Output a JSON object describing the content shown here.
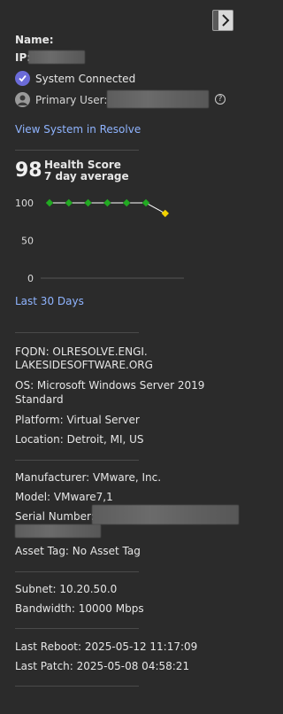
{
  "panel": {
    "collapse_icon": "chevron-right-icon"
  },
  "identity": {
    "name_label": "Name:",
    "ip_label": "IP:",
    "status_text": "System Connected",
    "primary_user_label": "Primary User:",
    "help_icon": "question-circle-icon",
    "help_glyph": "?",
    "view_link": "View System in Resolve"
  },
  "health": {
    "score": "98",
    "title": "Health Score",
    "subtitle": "7 day average",
    "range_link": "Last 30 Days",
    "colors": {
      "ok": "#22aa22",
      "warn": "#f2d100",
      "line": "#ffffff"
    },
    "chart_data": {
      "type": "line",
      "y_ticks": [
        "100",
        "50",
        "0"
      ],
      "ylim": [
        0,
        100
      ],
      "points": [
        {
          "value": 100,
          "status": "ok"
        },
        {
          "value": 100,
          "status": "ok"
        },
        {
          "value": 100,
          "status": "ok"
        },
        {
          "value": 100,
          "status": "ok"
        },
        {
          "value": 100,
          "status": "ok"
        },
        {
          "value": 100,
          "status": "ok"
        },
        {
          "value": 86,
          "status": "warn"
        }
      ]
    }
  },
  "system": {
    "fqdn_line1": "FQDN: OLRESOLVE.ENGI.",
    "fqdn_line2": "LAKESIDESOFTWARE.ORG",
    "os_line1": "OS: Microsoft Windows Server 2019",
    "os_line2": "Standard",
    "platform": "Platform: Virtual Server",
    "location": "Location: Detroit, MI, US"
  },
  "hardware": {
    "manufacturer": "Manufacturer: VMware, Inc.",
    "model": "Model: VMware7,1",
    "serial_label": "Serial Number:",
    "asset_tag": "Asset Tag: No Asset Tag"
  },
  "network": {
    "subnet": "Subnet: 10.20.50.0",
    "bandwidth": "Bandwidth: 10000 Mbps"
  },
  "events": {
    "last_reboot": "Last Reboot: 2025-05-12 11:17:09",
    "last_patch": "Last Patch: 2025-05-08 04:58:21"
  }
}
